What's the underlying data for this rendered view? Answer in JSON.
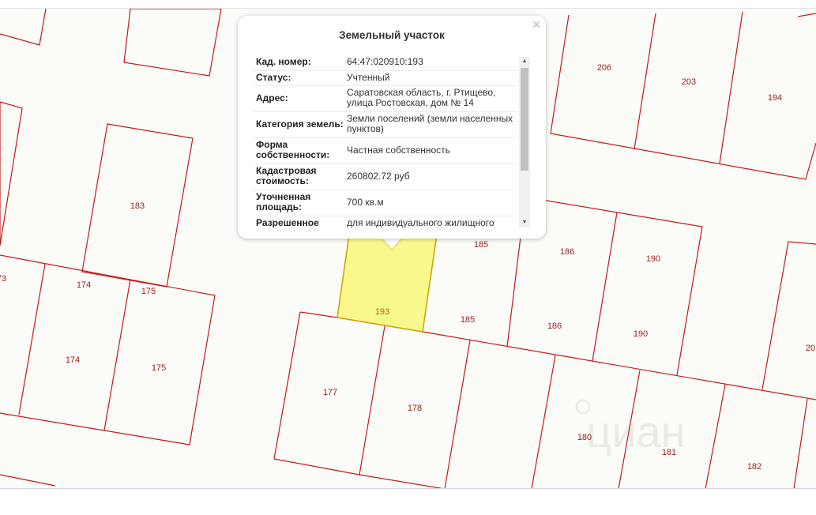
{
  "popup": {
    "title": "Земельный участок",
    "close_symbol": "×",
    "rows": [
      {
        "key": "Кад. номер:",
        "value": "64:47:020910:193"
      },
      {
        "key": "Статус:",
        "value": "Учтенный"
      },
      {
        "key": "Адрес:",
        "value": "Саратовская область, г. Ртищево, улица Ростовская, дом № 14"
      },
      {
        "key": "Категория земель:",
        "value": "Земли поселений (земли населенных пунктов)"
      },
      {
        "key": "Форма собственности:",
        "value": "Частная собственность"
      },
      {
        "key": "Кадастровая стоимость:",
        "value": "260802.72 руб"
      },
      {
        "key": "Уточненная площадь:",
        "value": "700 кв.м"
      },
      {
        "key": "Разрешенное",
        "value": "для индивидуального жилищного"
      }
    ]
  },
  "map": {
    "selected_parcel_label": "193",
    "selected_fill": "#f8f88c",
    "boundary_color": "#c21a1a",
    "parcel_labels": [
      "206",
      "203",
      "194",
      "183",
      "73",
      "174",
      "175",
      "174",
      "175",
      "185",
      "186",
      "190",
      "185",
      "186",
      "190",
      "20",
      "177",
      "178",
      "180",
      "181",
      "182"
    ],
    "watermark_text": "циан"
  }
}
